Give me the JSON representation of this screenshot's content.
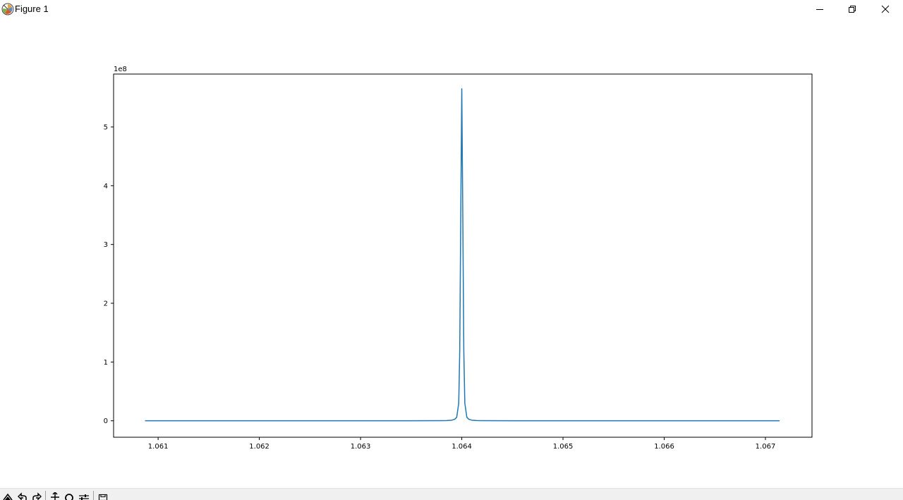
{
  "window": {
    "title": "Figure 1",
    "icon": "matplotlib-icon",
    "controls": [
      "minimize-icon",
      "restore-icon",
      "close-icon"
    ]
  },
  "toolbar": {
    "buttons": [
      "home-icon",
      "back-icon",
      "forward-icon",
      "pan-icon",
      "zoom-icon",
      "configure-subplots-icon",
      "save-icon"
    ]
  },
  "chart_data": {
    "type": "line",
    "title": "",
    "xlabel": "",
    "ylabel": "",
    "offset_text": "1e8",
    "grid": false,
    "color": "#1f77b4",
    "xlim": [
      1.06056,
      1.06746
    ],
    "ylim": [
      -0.28,
      5.9
    ],
    "x_ticks": [
      1.061,
      1.062,
      1.063,
      1.064,
      1.065,
      1.066,
      1.067
    ],
    "x_tick_labels": [
      "1.061",
      "1.062",
      "1.063",
      "1.064",
      "1.065",
      "1.066",
      "1.067"
    ],
    "y_ticks": [
      0,
      1,
      2,
      3,
      4,
      5
    ],
    "y_tick_labels": [
      "0",
      "1",
      "2",
      "3",
      "4",
      "5"
    ],
    "series": [
      {
        "x": [
          1.06087,
          1.0635,
          1.0638,
          1.06385,
          1.0639,
          1.06393,
          1.06395,
          1.06397,
          1.06398,
          1.06399,
          1.064,
          1.06401,
          1.06402,
          1.06403,
          1.06405,
          1.06407,
          1.0641,
          1.06415,
          1.0642,
          1.0645,
          1.06714
        ],
        "y": [
          0,
          0,
          0.002,
          0.004,
          0.01,
          0.025,
          0.06,
          0.3,
          1.2,
          3.5,
          5.65,
          3.5,
          1.2,
          0.3,
          0.06,
          0.025,
          0.01,
          0.004,
          0.002,
          0,
          0
        ]
      }
    ]
  }
}
